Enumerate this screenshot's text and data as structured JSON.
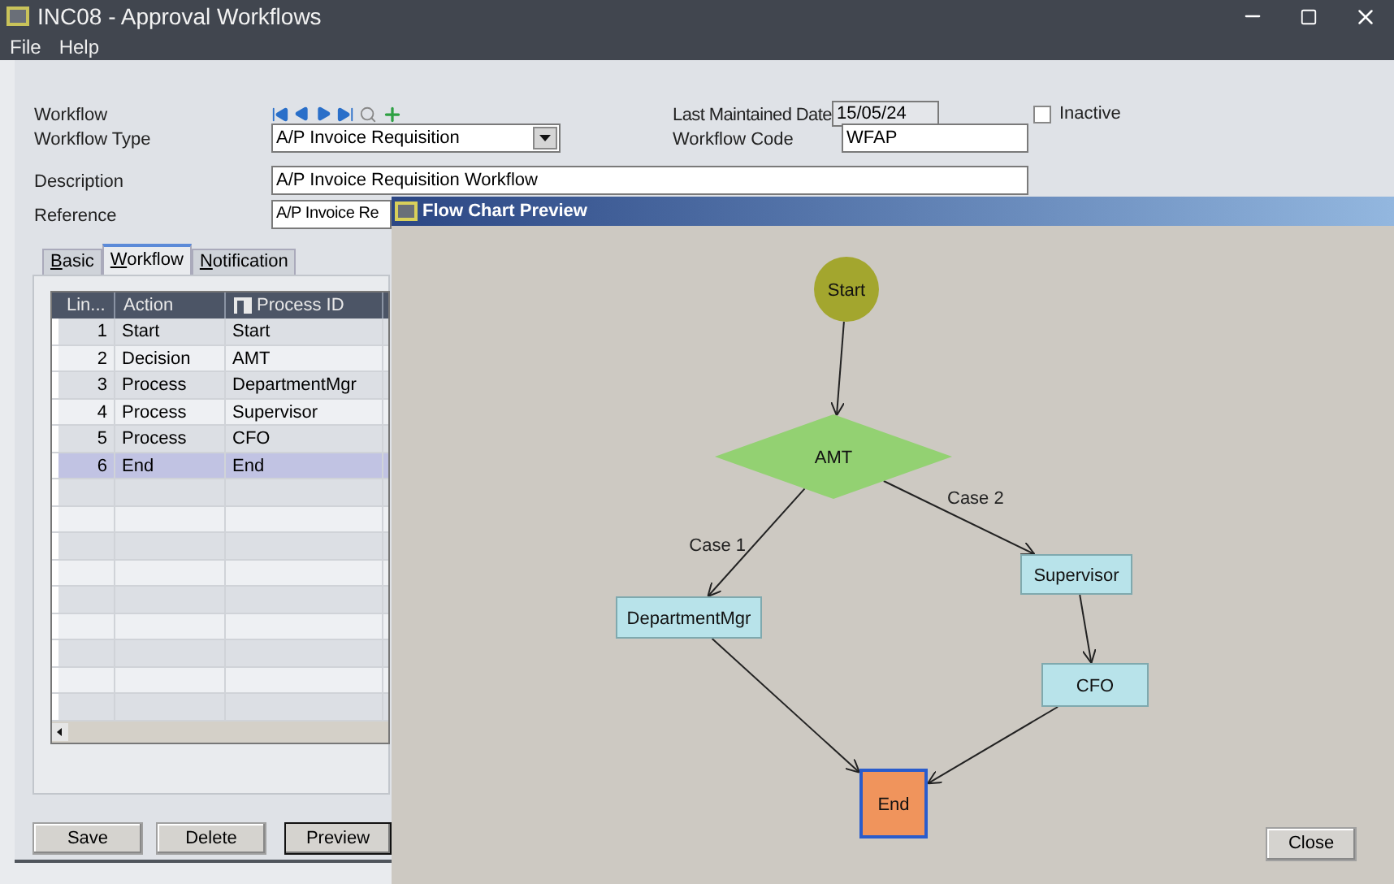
{
  "window": {
    "title": "INC08 - Approval Workflows"
  },
  "menu": [
    "File",
    "Help"
  ],
  "form": {
    "workflow": {
      "label": "Workflow"
    },
    "last_maintained": {
      "label": "Last Maintained Date",
      "value": "15/05/24"
    },
    "inactive": {
      "label": "Inactive",
      "checked": false
    },
    "workflow_type": {
      "label": "Workflow Type",
      "value": "A/P Invoice Requisition"
    },
    "workflow_code": {
      "label": "Workflow Code",
      "value": "WFAP"
    },
    "description": {
      "label": "Description",
      "value": "A/P Invoice Requisition Workflow"
    },
    "reference": {
      "label": "Reference",
      "value": "A/P Invoice Re"
    }
  },
  "tabs": [
    {
      "label": "Basic",
      "selected": false
    },
    {
      "label": "Workflow",
      "selected": true
    },
    {
      "label": "Notification",
      "selected": false
    }
  ],
  "table": {
    "columns": [
      {
        "label": "Lin...",
        "kind": "number"
      },
      {
        "label": "Action",
        "kind": "text"
      },
      {
        "label": "Process ID",
        "kind": "key"
      }
    ],
    "rows": [
      {
        "cells": [
          "1",
          "Start",
          "Start"
        ],
        "selected": false
      },
      {
        "cells": [
          "2",
          "Decision",
          "AMT"
        ],
        "selected": false
      },
      {
        "cells": [
          "3",
          "Process",
          "DepartmentMgr"
        ],
        "selected": false
      },
      {
        "cells": [
          "4",
          "Process",
          "Supervisor"
        ],
        "selected": false
      },
      {
        "cells": [
          "5",
          "Process",
          "CFO"
        ],
        "selected": false
      },
      {
        "cells": [
          "6",
          "End",
          "End"
        ],
        "selected": true
      }
    ]
  },
  "buttons": [
    {
      "label": "Save",
      "default": false
    },
    {
      "label": "Delete",
      "default": false
    },
    {
      "label": "Preview",
      "default": true
    }
  ],
  "preview": {
    "title": "Flow Chart Preview",
    "nodes": [
      {
        "kind": "start",
        "label": "Start"
      },
      {
        "kind": "decision",
        "label": "AMT"
      },
      {
        "kind": "process",
        "label": "DepartmentMgr"
      },
      {
        "kind": "process",
        "label": "Supervisor"
      },
      {
        "kind": "process",
        "label": "CFO"
      },
      {
        "kind": "end",
        "label": "End"
      }
    ],
    "edges": [
      {
        "kind": "plain"
      },
      {
        "kind": "case",
        "label": "Case 1"
      },
      {
        "kind": "case",
        "label": "Case 2"
      },
      {
        "kind": "plain"
      },
      {
        "kind": "plain"
      },
      {
        "kind": "plain"
      }
    ],
    "close": "Close"
  }
}
